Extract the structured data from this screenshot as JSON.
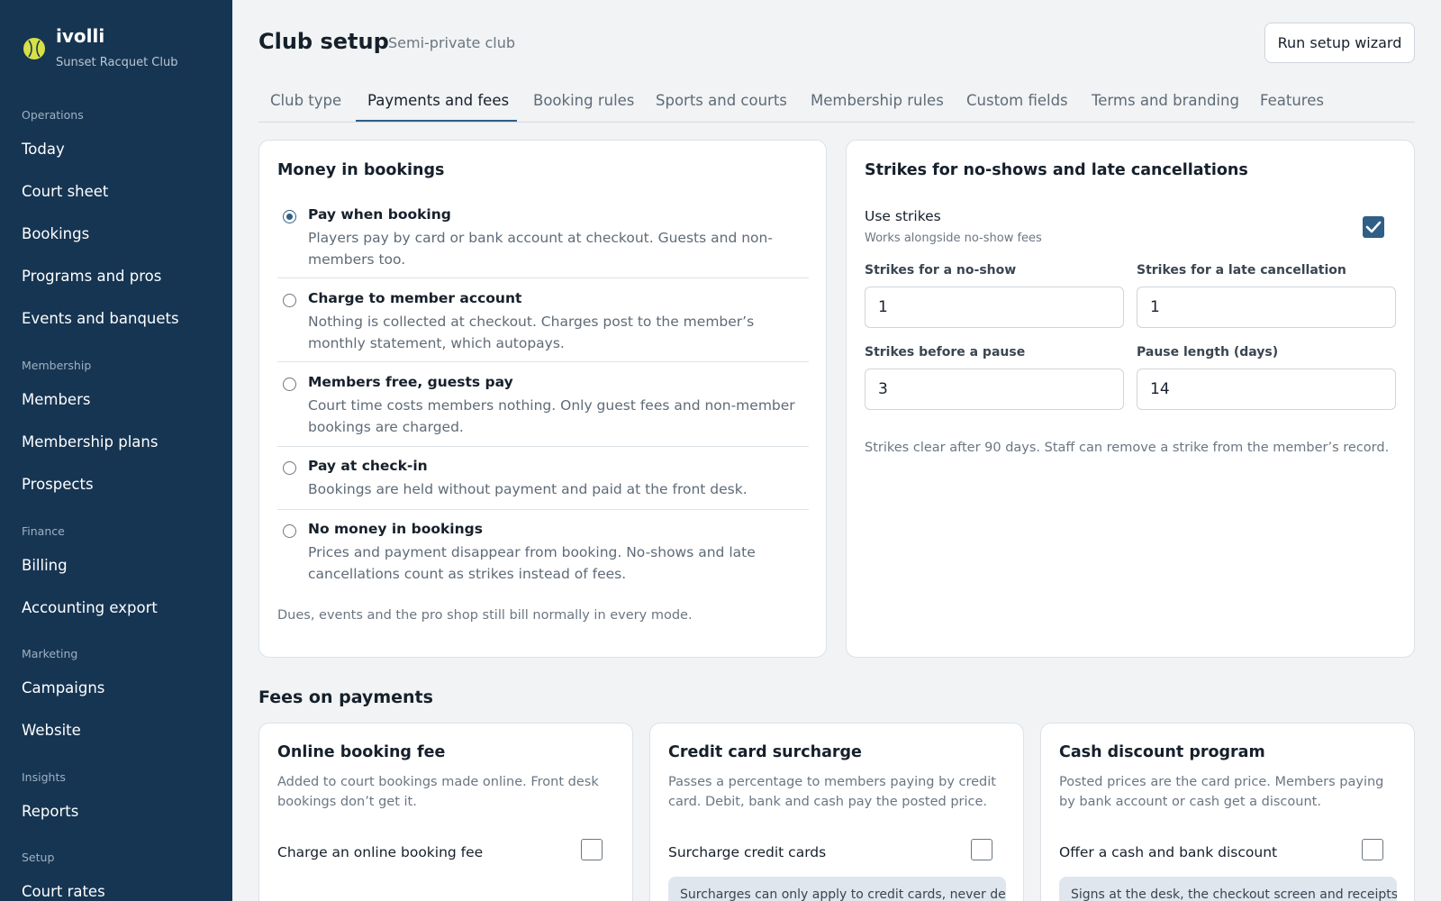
{
  "brand": {
    "name": "ivolli",
    "club": "Sunset Racquet Club",
    "logo_icon": "tennis-ball-icon"
  },
  "sidebar": {
    "sections": [
      {
        "label": "Operations",
        "items": [
          "Today",
          "Court sheet",
          "Bookings",
          "Programs and pros",
          "Events and banquets"
        ]
      },
      {
        "label": "Membership",
        "items": [
          "Members",
          "Membership plans",
          "Prospects"
        ]
      },
      {
        "label": "Finance",
        "items": [
          "Billing",
          "Accounting export"
        ]
      },
      {
        "label": "Marketing",
        "items": [
          "Campaigns",
          "Website"
        ]
      },
      {
        "label": "Insights",
        "items": [
          "Reports"
        ]
      },
      {
        "label": "Setup",
        "items": [
          "Court rates"
        ]
      }
    ]
  },
  "header": {
    "title": "Club setup",
    "subtitle": "Semi-private club",
    "wizard_label": "Run setup wizard"
  },
  "tabs": [
    "Club type",
    "Payments and fees",
    "Booking rules",
    "Sports and courts",
    "Membership rules",
    "Custom fields",
    "Terms and branding",
    "Features"
  ],
  "active_tab": "Payments and fees",
  "money": {
    "title": "Money in bookings",
    "options": [
      {
        "title": "Pay when booking",
        "desc": "Players pay by card or bank account at checkout. Guests and non-members too.",
        "selected": true
      },
      {
        "title": "Charge to member account",
        "desc": "Nothing is collected at checkout. Charges post to the member’s monthly statement, which autopays.",
        "selected": false
      },
      {
        "title": "Members free, guests pay",
        "desc": "Court time costs members nothing. Only guest fees and non-member bookings are charged.",
        "selected": false
      },
      {
        "title": "Pay at check-in",
        "desc": "Bookings are held without payment and paid at the front desk.",
        "selected": false
      },
      {
        "title": "No money in bookings",
        "desc": "Prices and payment disappear from booking. No-shows and late cancellations count as strikes instead of fees.",
        "selected": false
      }
    ],
    "note": "Dues, events and the pro shop still bill normally in every mode."
  },
  "strikes": {
    "title": "Strikes for no-shows and late cancellations",
    "use_label": "Use strikes",
    "use_sub": "Works alongside no-show fees",
    "use_checked": true,
    "no_show_label": "Strikes for a no-show",
    "no_show_value": "1",
    "late_cancel_label": "Strikes for a late cancellation",
    "late_cancel_value": "1",
    "before_pause_label": "Strikes before a pause",
    "before_pause_value": "3",
    "pause_length_label": "Pause length (days)",
    "pause_length_value": "14",
    "note": "Strikes clear after 90 days. Staff can remove a strike from the member’s record."
  },
  "fees": {
    "section_title": "Fees on payments",
    "online": {
      "title": "Online booking fee",
      "desc": "Added to court bookings made online. Front desk bookings don’t get it.",
      "toggle_label": "Charge an online booking fee",
      "checked": false
    },
    "surcharge": {
      "title": "Credit card surcharge",
      "desc": "Passes a percentage to members paying by credit card. Debit, bank and cash pay the posted price.",
      "toggle_label": "Surcharge credit cards",
      "checked": false,
      "info": "Surcharges can only apply to credit cards, never debit"
    },
    "cash": {
      "title": "Cash discount program",
      "desc": "Posted prices are the card price. Members paying by bank account or cash get a discount.",
      "toggle_label": "Offer a cash and bank discount",
      "checked": false,
      "info": "Signs at the desk, the checkout screen and receipts"
    }
  },
  "colors": {
    "sidebar_bg": "#163552",
    "accent": "#2f5f86",
    "logo": "#d7e047"
  }
}
